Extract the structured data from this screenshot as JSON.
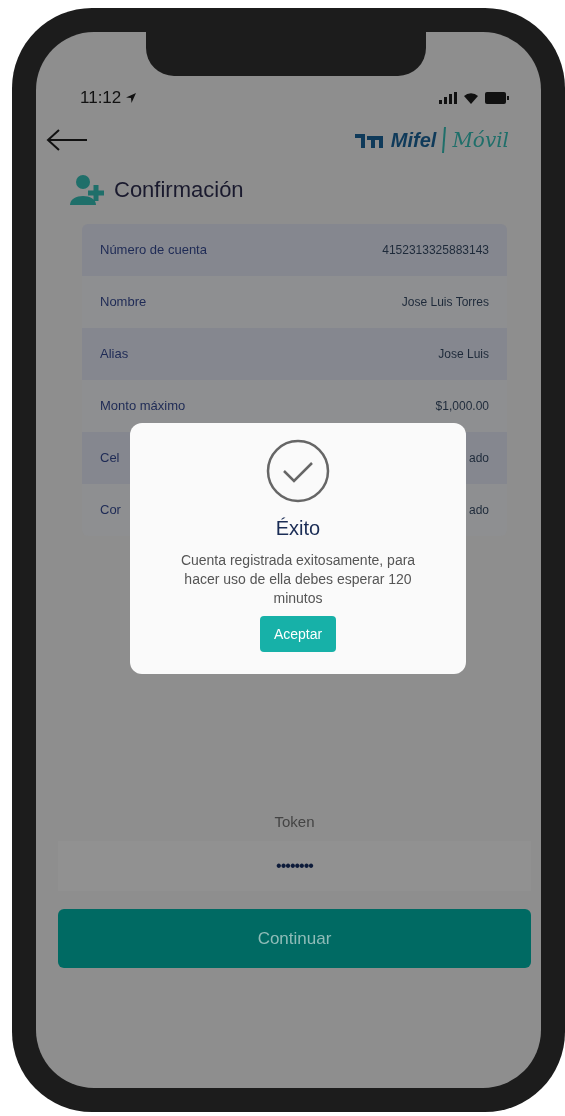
{
  "status_bar": {
    "time": "11:12"
  },
  "header": {
    "logo_brand": "Mifel",
    "logo_product": "Móvil"
  },
  "title": "Confirmación",
  "details": [
    {
      "label": "Número de cuenta",
      "value": "4152313325883143"
    },
    {
      "label": "Nombre",
      "value": "Jose Luis Torres"
    },
    {
      "label": "Alias",
      "value": "Jose Luis"
    },
    {
      "label": "Monto máximo",
      "value": "$1,000.00"
    },
    {
      "label": "Cel",
      "value": "ado"
    },
    {
      "label": "Cor",
      "value": "ado"
    }
  ],
  "token": {
    "label": "Token",
    "value": "••••••••"
  },
  "continue_button": "Continuar",
  "dialog": {
    "title": "Éxito",
    "message": "Cuenta registrada exitosamente, para hacer uso de ella debes esperar 120 minutos",
    "button": "Aceptar"
  }
}
